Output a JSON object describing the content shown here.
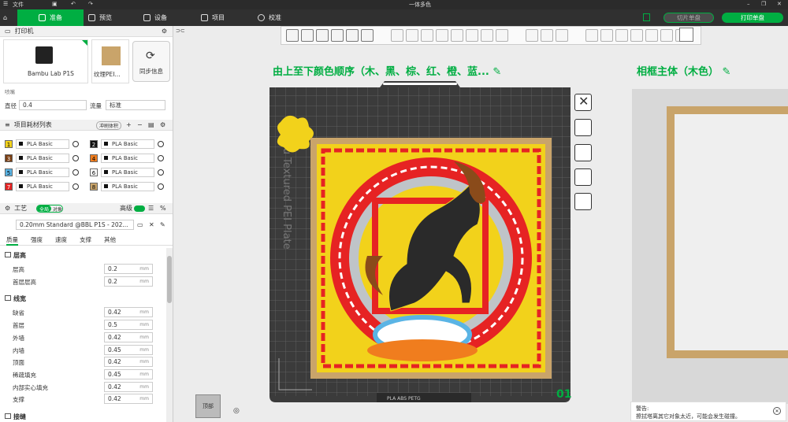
{
  "window": {
    "file_menu": "文件",
    "title": "一体多色"
  },
  "nav": {
    "tabs": [
      {
        "label": "准备"
      },
      {
        "label": "预览"
      },
      {
        "label": "设备"
      },
      {
        "label": "项目"
      },
      {
        "label": "校准"
      }
    ],
    "slice_btn": "切片单盘",
    "print_btn": "打印单盘"
  },
  "printer": {
    "section": "打印机",
    "name": "Bambu Lab P1S",
    "plate": "纹理PEI...",
    "sync": "同步信息",
    "nozzle_label": "喷嘴",
    "diameter_label": "直径",
    "diameter": "0.4",
    "flow_label": "流量",
    "flow": "标准"
  },
  "filaments": {
    "section": "项目耗材列表",
    "wipe": "冲刷体积",
    "items": [
      {
        "n": "1",
        "name": "PLA Basic",
        "color": "#f2d21b"
      },
      {
        "n": "2",
        "name": "PLA Basic",
        "color": "#111111"
      },
      {
        "n": "3",
        "name": "PLA Basic",
        "color": "#7a3e12"
      },
      {
        "n": "4",
        "name": "PLA Basic",
        "color": "#f07d1e"
      },
      {
        "n": "5",
        "name": "PLA Basic",
        "color": "#5ab4e5"
      },
      {
        "n": "6",
        "name": "PLA Basic",
        "color": "#ffffff"
      },
      {
        "n": "7",
        "name": "PLA Basic",
        "color": "#e62323"
      },
      {
        "n": "8",
        "name": "PLA Basic",
        "color": "#c9a46a"
      }
    ]
  },
  "process": {
    "section": "工艺",
    "toggle_global": "全局",
    "toggle_object": "对象",
    "advanced": "高级",
    "preset": "0.20mm Standard @BBL P1S - 202...",
    "tabs": [
      "质量",
      "强度",
      "速度",
      "支撑",
      "其他"
    ],
    "groups": [
      {
        "title": "层高",
        "rows": [
          {
            "label": "层高",
            "value": "0.2"
          },
          {
            "label": "首层层高",
            "value": "0.2"
          }
        ]
      },
      {
        "title": "线宽",
        "rows": [
          {
            "label": "缺省",
            "value": "0.42"
          },
          {
            "label": "首层",
            "value": "0.5"
          },
          {
            "label": "外墙",
            "value": "0.42"
          },
          {
            "label": "内墙",
            "value": "0.45"
          },
          {
            "label": "顶面",
            "value": "0.42"
          },
          {
            "label": "稀疏填充",
            "value": "0.45"
          },
          {
            "label": "内部实心填充",
            "value": "0.42"
          },
          {
            "label": "支撑",
            "value": "0.42"
          }
        ]
      },
      {
        "title": "接缝",
        "rows": []
      }
    ],
    "unit": "mm"
  },
  "canvas": {
    "plate1_label": "由上至下颜色顺序（木、黑、棕、红、橙、蓝...",
    "plate2_label": "相框主体（木色）",
    "plate_text": "Bambu Textured PEI Plate",
    "plate_number": "01",
    "plate_bottom": "PLA ABS PETG",
    "view_cube": "顶部",
    "warning": {
      "title": "警告:",
      "text": "擦拭塔离其它对象太近，可能会发生碰撞。"
    }
  },
  "colors": {
    "accent": "#00ae42",
    "dark": "#2b2b2b"
  }
}
